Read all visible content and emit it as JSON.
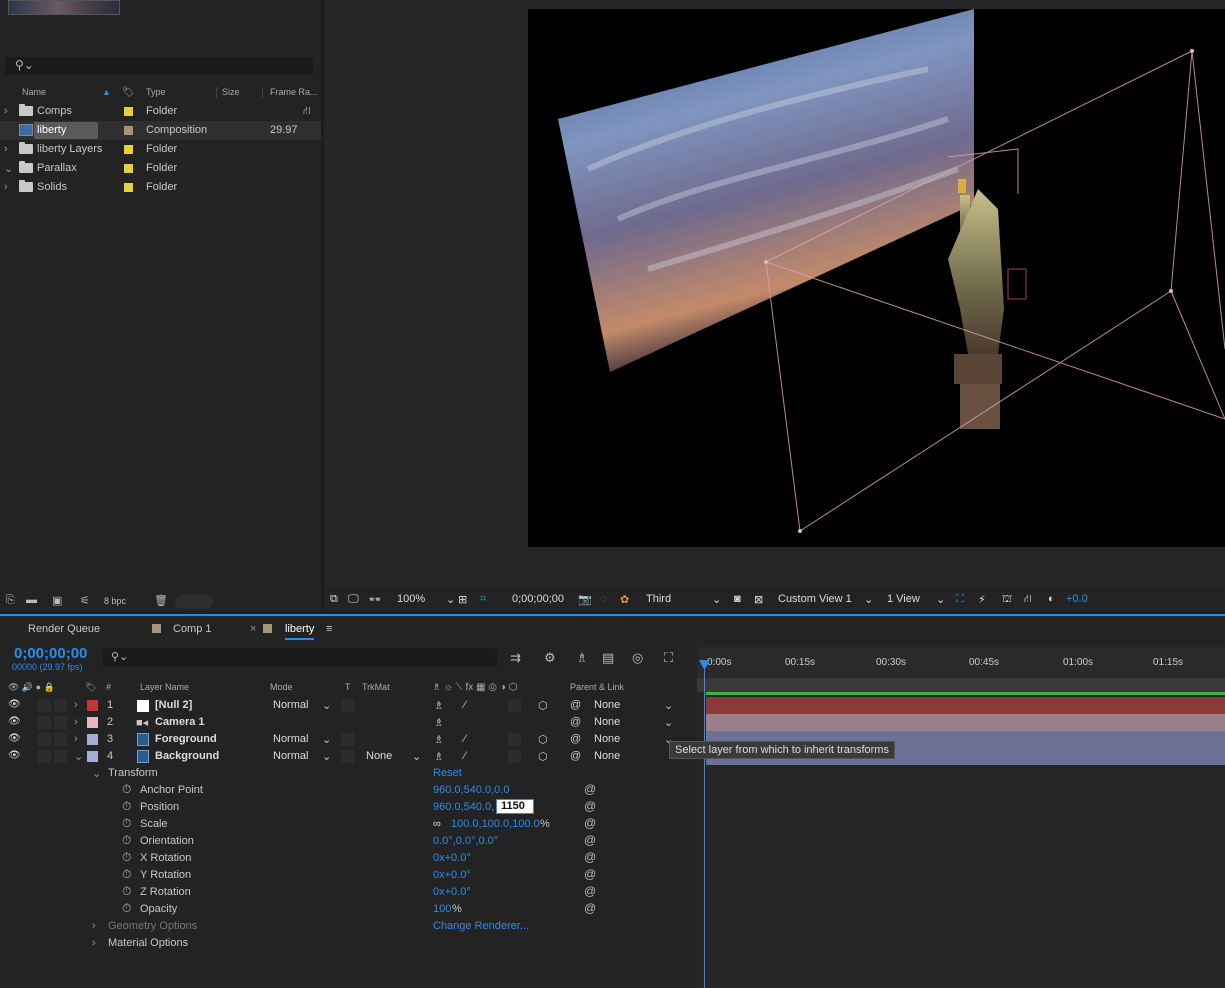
{
  "project": {
    "search_icon": "search-icon",
    "columns": {
      "name": "Name",
      "type": "Type",
      "size": "Size",
      "frame_rate": "Frame Ra..."
    },
    "items": [
      {
        "name": "Comps",
        "type": "Folder",
        "frame_rate": "",
        "expanded": false
      },
      {
        "name": "liberty",
        "type": "Composition",
        "frame_rate": "29.97",
        "selected": true
      },
      {
        "name": "liberty Layers",
        "type": "Folder",
        "frame_rate": "",
        "expanded": false
      },
      {
        "name": "Parallax",
        "type": "Folder",
        "frame_rate": "",
        "expanded": true
      },
      {
        "name": "Solids",
        "type": "Folder",
        "frame_rate": "",
        "expanded": false
      }
    ],
    "bit_depth": "8 bpc"
  },
  "viewer": {
    "zoom": "100%",
    "timecode": "0;00;00;00",
    "channel": "Third",
    "view": "Custom View 1",
    "layout": "1 View",
    "exposure": "+0.0"
  },
  "tabs": {
    "render_queue": "Render Queue",
    "comp1": "Comp 1",
    "liberty": "liberty"
  },
  "timeline": {
    "timecode": "0;00;00;00",
    "fps": "00000 (29.97 fps)",
    "columns": {
      "num": "#",
      "layer_name": "Layer Name",
      "mode": "Mode",
      "t": "T",
      "trkmat": "TrkMat",
      "parent": "Parent & Link"
    },
    "ruler": [
      "0:00s",
      "00:15s",
      "00:30s",
      "00:45s",
      "01:00s",
      "01:15s"
    ],
    "layers": [
      {
        "num": "1",
        "name": "[Null 2]",
        "mode": "Normal",
        "trkmat": "",
        "parent": "None",
        "color": "#c13636"
      },
      {
        "num": "2",
        "name": "Camera 1",
        "mode": "",
        "trkmat": "",
        "parent": "None",
        "color": "#e4b7c2"
      },
      {
        "num": "3",
        "name": "Foreground",
        "mode": "Normal",
        "trkmat": "",
        "parent": "None",
        "color": "#a7acd6"
      },
      {
        "num": "4",
        "name": "Background",
        "mode": "Normal",
        "trkmat": "None",
        "parent": "None",
        "color": "#a7acd6"
      }
    ],
    "transform": {
      "label": "Transform",
      "reset": "Reset",
      "properties": [
        {
          "name": "Anchor Point",
          "value": "960.0,540.0,0.0"
        },
        {
          "name": "Position",
          "value": "960.0,540.0,",
          "edit": "1150"
        },
        {
          "name": "Scale",
          "value": "100.0,100.0,100.0",
          "suffix": "%"
        },
        {
          "name": "Orientation",
          "value": "0.0°,0.0°,0.0°"
        },
        {
          "name": "X Rotation",
          "value": "0x+0.0°"
        },
        {
          "name": "Y Rotation",
          "value": "0x+0.0°"
        },
        {
          "name": "Z Rotation",
          "value": "0x+0.0°"
        },
        {
          "name": "Opacity",
          "value": "100",
          "suffix": "%"
        }
      ]
    },
    "geometry_options": "Geometry Options",
    "change_renderer": "Change Renderer...",
    "material_options": "Material Options",
    "tooltip": "Select layer from which to inherit transforms"
  }
}
